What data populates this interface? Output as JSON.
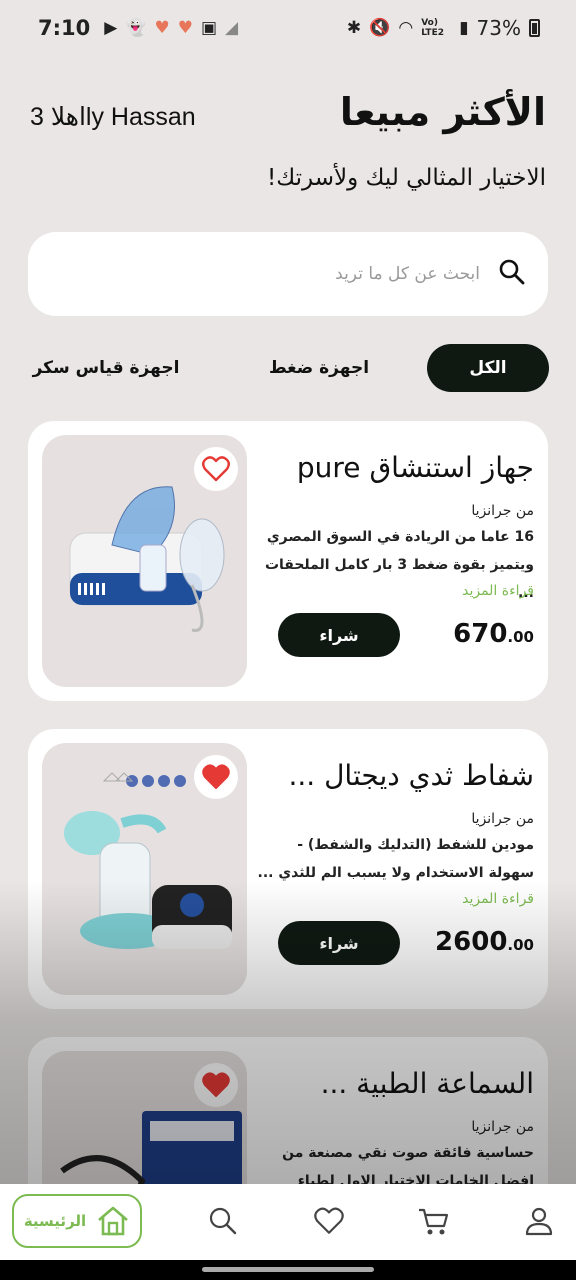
{
  "status_bar": {
    "time": "7:10",
    "battery": "73%",
    "network": "Vo) LTE2"
  },
  "header": {
    "greeting": "اهلا 3ly Hassan",
    "title": "الأكثر مبيعا",
    "subtitle": "الاختيار المثالي ليك ولأسرتك!"
  },
  "search": {
    "placeholder": "ابحث عن كل ما تريد",
    "value": ""
  },
  "tabs": [
    {
      "label": "الكل",
      "active": true
    },
    {
      "label": "اجهزة ضغط",
      "active": false
    },
    {
      "label": "اجهزة قياس سكر",
      "active": false
    }
  ],
  "products": [
    {
      "title": "جهاز استنشاق pure",
      "brand": "من جرانزيا",
      "desc_line1": "16 عاما من الريادة في السوق المصري",
      "desc_line2": "ويتميز بقوة ضغط 3 بار كامل الملحقات ...",
      "read_more": "قراءة المزيد",
      "price_int": "670",
      "price_dec": ".00",
      "buy_label": "شراء",
      "favorited": false
    },
    {
      "title": "شفاط ثدي ديجتال ...",
      "brand": "من جرانزيا",
      "desc_line1": "مودين للشفط (التدليك والشفط) -",
      "desc_line2": "سهولة الاستخدام ولا يسبب الم للثدي ...",
      "read_more": "قراءة المزيد",
      "price_int": "2600",
      "price_dec": ".00",
      "buy_label": "شراء",
      "favorited": true
    },
    {
      "title": "السماعة الطبية ...",
      "brand": "من جرانزيا",
      "desc_line1": "حساسية فائقة صوت نقي مصنعة من",
      "desc_line2": "افضل الخامات الاختيار الاول لطباء",
      "favorited": true
    }
  ],
  "bottom_nav": {
    "home_label": "الرئيسية",
    "items": [
      "home-icon",
      "search-icon",
      "heart-icon",
      "cart-icon",
      "profile-icon"
    ]
  },
  "colors": {
    "accent": "#7cba52",
    "dark": "#0f1912",
    "background": "#e9e6e5",
    "favorite": "#e53935"
  }
}
